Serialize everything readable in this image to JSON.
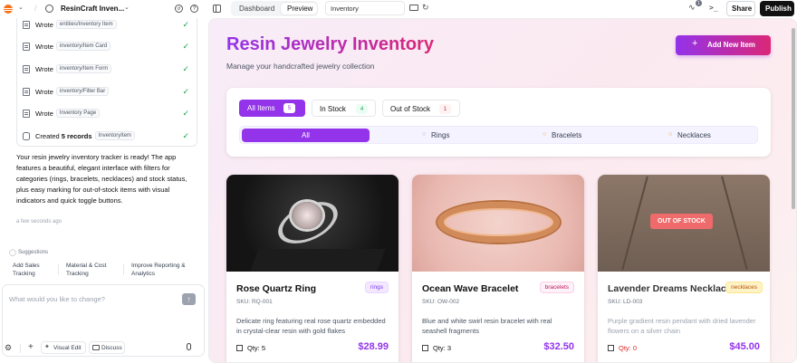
{
  "topbar": {
    "app_name": "ResinCraft Inven...",
    "tab_dashboard": "Dashboard",
    "tab_preview": "Preview",
    "page_select": "Inventory",
    "badge_count": "1",
    "share": "Share",
    "publish": "Publish"
  },
  "chat": {
    "log": [
      {
        "verb": "Wrote",
        "chip": "entities/Inventory Item"
      },
      {
        "verb": "Wrote",
        "chip": "inventory/Item Card"
      },
      {
        "verb": "Wrote",
        "chip": "inventory/Item Form"
      },
      {
        "verb": "Wrote",
        "chip": "inventory/Filter Bar"
      },
      {
        "verb": "Wrote",
        "chip": "Inventory Page"
      }
    ],
    "created_prefix": "Created",
    "created_bold": "5 records",
    "created_chip": "InventoryItem",
    "message": "Your resin jewelry inventory tracker is ready! The app features a beautiful, elegant interface with filters for categories (rings, bracelets, necklaces) and stock status, plus easy marking for out-of-stock items with visual indicators and quick toggle buttons.",
    "timestamp": "a few seconds ago",
    "suggestions_label": "Suggestions",
    "suggestions": [
      "Add Sales Tracking",
      "Material & Cost Tracking",
      "Improve Reporting & Analytics"
    ],
    "input_placeholder": "What would you like to change?",
    "visual_edit": "Visual Edit",
    "discuss": "Discuss"
  },
  "app": {
    "title": "Resin Jewelry Inventory",
    "subtitle": "Manage your handcrafted jewelry collection",
    "add_button": "Add New Item",
    "stock_filters": [
      {
        "label": "All Items",
        "count": "5"
      },
      {
        "label": "In Stock",
        "count": "4"
      },
      {
        "label": "Out of Stock",
        "count": "1"
      }
    ],
    "category_filters": [
      "All",
      "Rings",
      "Bracelets",
      "Necklaces"
    ],
    "items": [
      {
        "name": "Rose Quartz Ring",
        "category": "rings",
        "sku": "SKU: RQ-001",
        "description": "Delicate ring featuring real rose quartz embedded in crystal-clear resin with gold flakes",
        "qty": "Qty: 5",
        "price": "$28.99",
        "badge": ""
      },
      {
        "name": "Ocean Wave Bracelet",
        "category": "bracelets",
        "sku": "SKU: OW-002",
        "description": "Blue and white swirl resin bracelet with real seashell fragments",
        "qty": "Qty: 3",
        "price": "$32.50",
        "badge": ""
      },
      {
        "name": "Lavender Dreams Necklace",
        "category": "necklaces",
        "sku": "SKU: LD-003",
        "description": "Purple gradient resin pendant with dried lavender flowers on a silver chain",
        "qty": "Qty: 0",
        "price": "$45.00",
        "badge": "OUT OF STOCK"
      }
    ]
  },
  "colors": {
    "accent": "#9333ea",
    "title_gradient_start": "#9333ea",
    "title_gradient_end": "#db2777",
    "out_of_stock": "#ef6b6b",
    "in_stock": "#16a34a"
  }
}
